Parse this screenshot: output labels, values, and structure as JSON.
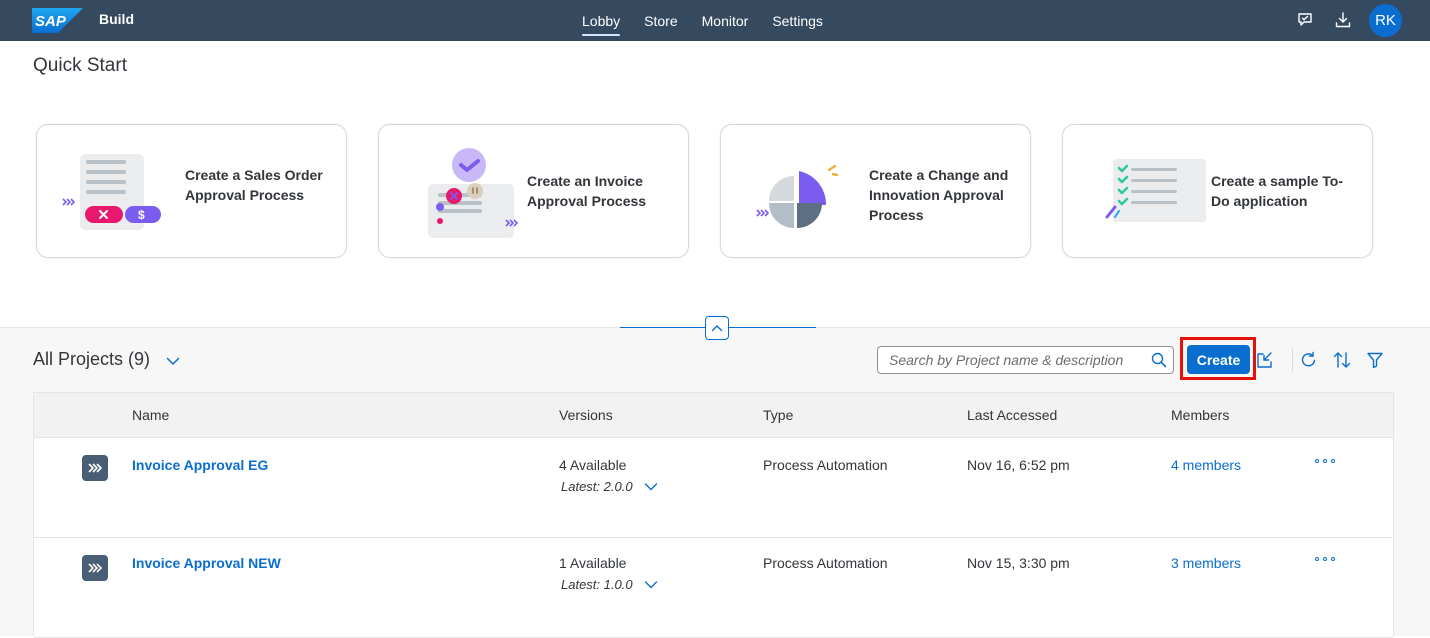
{
  "shell": {
    "logo_text": "SAP",
    "product": "Build",
    "nav": [
      {
        "label": "Lobby",
        "active": true
      },
      {
        "label": "Store",
        "active": false
      },
      {
        "label": "Monitor",
        "active": false
      },
      {
        "label": "Settings",
        "active": false
      }
    ],
    "icons": [
      "feedback-icon",
      "download-icon"
    ],
    "avatar_initials": "RK"
  },
  "quick_start": {
    "title": "Quick Start",
    "cards": [
      {
        "label": "Create a Sales Order Approval Process"
      },
      {
        "label": "Create an Invoice Approval Process"
      },
      {
        "label": "Create a Change and Innovation Approval Process"
      },
      {
        "label": "Create a sample To-Do application"
      }
    ]
  },
  "projects": {
    "title": "All Projects (9)",
    "search_placeholder": "Search by Project name & description",
    "create_label": "Create",
    "columns": [
      "Name",
      "Versions",
      "Type",
      "Last Accessed",
      "Members"
    ],
    "rows": [
      {
        "name": "Invoice Approval EG",
        "versions": "4 Available",
        "latest": "Latest: 2.0.0",
        "type": "Process Automation",
        "last_accessed": "Nov 16, 6:52 pm",
        "members": "4 members"
      },
      {
        "name": "Invoice Approval NEW",
        "versions": "1 Available",
        "latest": "Latest: 1.0.0",
        "type": "Process Automation",
        "last_accessed": "Nov 15, 3:30 pm",
        "members": "3 members"
      }
    ]
  },
  "colors": {
    "shell_bg": "#354a5f",
    "brand_blue": "#0a6ed1",
    "highlight_red": "#e8110a",
    "purple_accent": "#7b5cf0",
    "magenta_accent": "#e8186e",
    "green_accent": "#2dc99b"
  }
}
